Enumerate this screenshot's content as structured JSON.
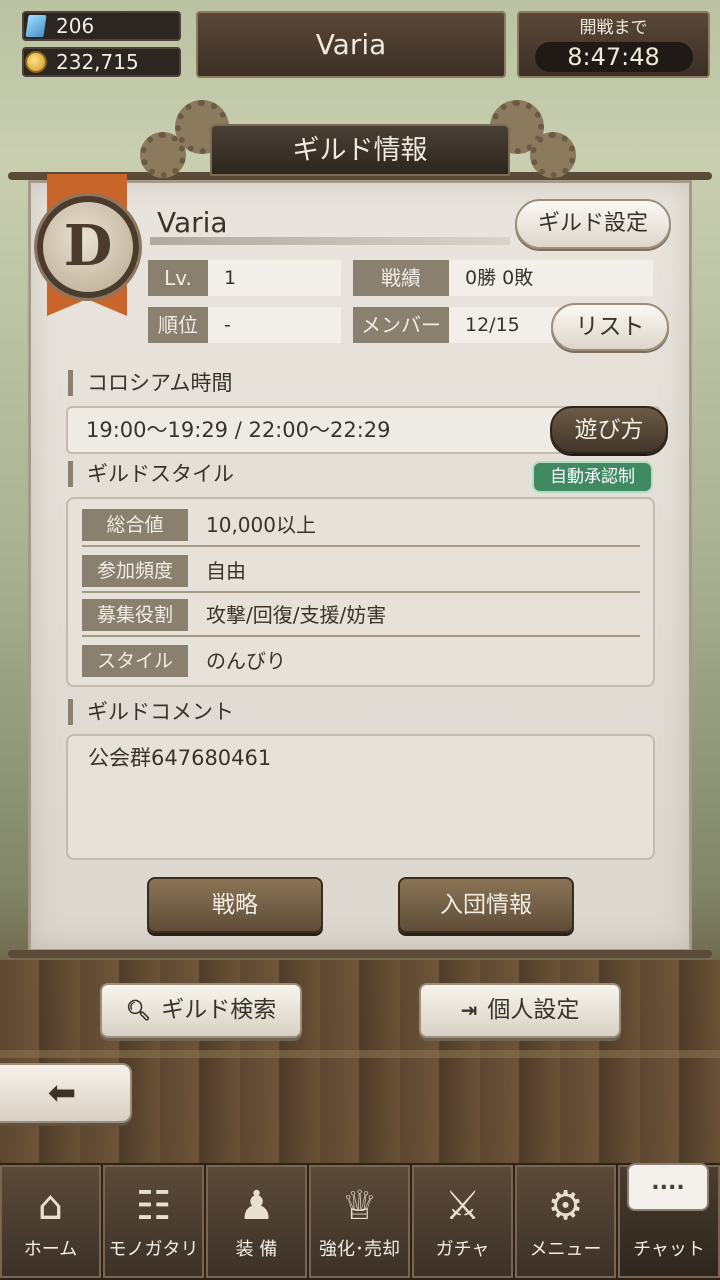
{
  "hud": {
    "gems": "206",
    "coins": "232,715",
    "player_name": "Varia",
    "battle_label": "開戦まで",
    "battle_time": "8:47:48"
  },
  "panel": {
    "title": "ギルド情報",
    "emblem_letter": "D",
    "guild_name": "Varia",
    "settings_button": "ギルド設定",
    "stats": {
      "level_label": "Lv.",
      "level_value": "1",
      "record_label": "戦績",
      "record_value": "0勝 0敗",
      "rank_label": "順位",
      "rank_value": "-",
      "member_label": "メンバー",
      "member_value": "12/15",
      "list_button": "リスト"
    },
    "colosseum": {
      "title": "コロシアム時間",
      "times": "19:00〜19:29 / 22:00〜22:29",
      "howto_button": "遊び方"
    },
    "style": {
      "title": "ギルドスタイル",
      "auto_badge": "自動承認制",
      "rows": [
        {
          "label": "総合値",
          "value": "10,000以上"
        },
        {
          "label": "参加頻度",
          "value": "自由"
        },
        {
          "label": "募集役割",
          "value": "攻撃/回復/支援/妨害"
        },
        {
          "label": "スタイル",
          "value": "のんびり"
        }
      ]
    },
    "comment": {
      "title": "ギルドコメント",
      "text": "公会群647680461"
    },
    "strategy_button": "戦略",
    "join_info_button": "入団情報"
  },
  "actions": {
    "search_button": "ギルド検索",
    "personal_button": "個人設定"
  },
  "nav": [
    {
      "label": "ホーム",
      "icon": "home-icon"
    },
    {
      "label": "モノガタリ",
      "icon": "book-icon"
    },
    {
      "label": "装 備",
      "icon": "puppet-icon"
    },
    {
      "label": "強化･売却",
      "icon": "helmet-icon"
    },
    {
      "label": "ガチャ",
      "icon": "swords-icon"
    },
    {
      "label": "メニュー",
      "icon": "gears-icon"
    },
    {
      "label": "チャット",
      "icon": "chat-icon"
    }
  ],
  "chat_bubble": "....",
  "colors": {
    "panel_bg": "#e9e5de",
    "label_bg": "#8a8070",
    "badge_green": "#3f8a62",
    "ribbon_orange": "#c7652a"
  }
}
